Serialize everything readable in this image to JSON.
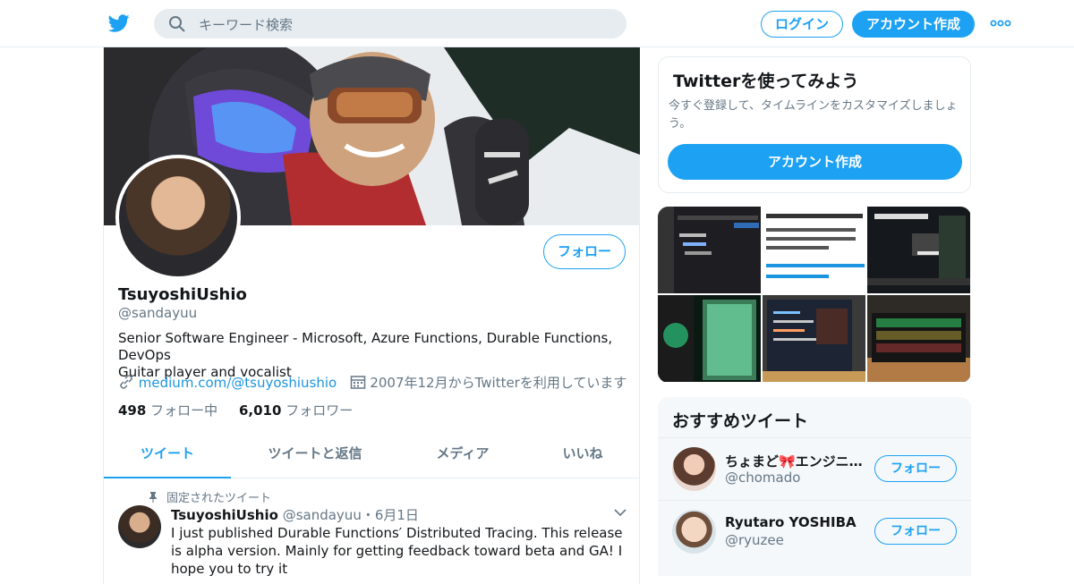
{
  "header": {
    "logo_icon": "twitter-bird-icon",
    "search_placeholder": "キーワード検索",
    "login_label": "ログイン",
    "signup_label": "アカウント作成",
    "more_icon": "more-dots-icon",
    "accent": "#1da1f2"
  },
  "profile": {
    "name": "TsuyoshiUshio",
    "handle": "@sandayuu",
    "follow_label": "フォロー",
    "bio_line1": "Senior Software Engineer - Microsoft, Azure Functions, Durable Functions, DevOps",
    "bio_line2": "Guitar player and vocalist",
    "link": "medium.com/@tsuyoshiushio",
    "joined": "2007年12月からTwitterを利用しています",
    "following_count": "498",
    "following_label": "フォロー中",
    "followers_count": "6,010",
    "followers_label": "フォロワー"
  },
  "tabs": [
    {
      "label": "ツイート"
    },
    {
      "label": "ツイートと返信"
    },
    {
      "label": "メディア"
    },
    {
      "label": "いいね"
    }
  ],
  "tweet": {
    "pinned_label": "固定されたツイート",
    "name": "TsuyoshiUshio",
    "handle": "@sandayuu",
    "date": "・6月1日",
    "text": "I just published Durable Functions′ Distributed Tracing. This release is alpha version. Mainly for getting feedback toward beta and GA! I hope you to try it"
  },
  "signup_card": {
    "title": "Twitterを使ってみよう",
    "desc": "今すぐ登録して、タイムラインをカスタマイズしましょう。",
    "button": "アカウント作成"
  },
  "recommend": {
    "title": "おすすめツイート",
    "items": [
      {
        "name": "ちょまど🎀エンジニ…",
        "handle": "@chomado",
        "follow": "フォロー"
      },
      {
        "name": "Ryutaro YOSHIBA",
        "handle": "@ryuzee",
        "follow": "フォロー"
      }
    ]
  }
}
